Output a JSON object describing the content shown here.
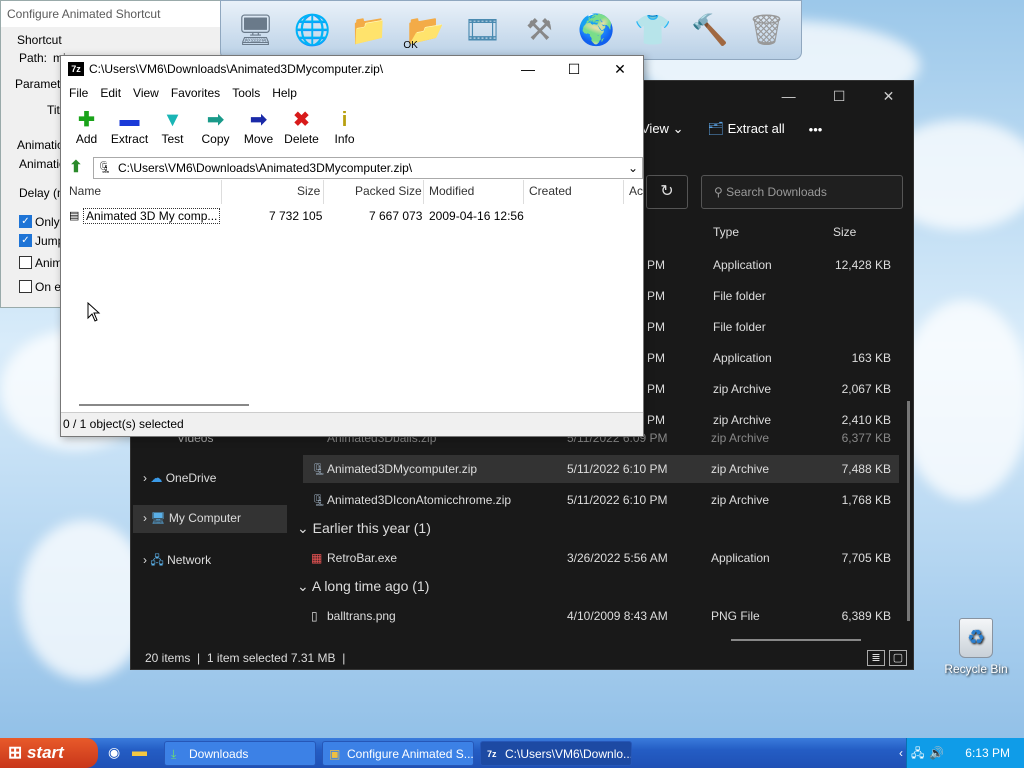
{
  "desktop": {
    "recycle_bin": "Recycle Bin"
  },
  "configure_window": {
    "title": "Configure Animated Shortcut",
    "shortcut_group": "Shortcut",
    "path_label": "Path:",
    "path_value": "mi...",
    "parameters_label": "Paramete",
    "title_label": "Titl",
    "animation_label_1": "Animatio",
    "animation_label_2": "Animatio",
    "delay_label": "Delay (m",
    "only_label": "Only",
    "jump_label": "Jump",
    "anim_label": "Anim",
    "on_label": "On e",
    "ok_label": "OK"
  },
  "zip": {
    "title": "C:\\Users\\VM6\\Downloads\\Animated3DMycomputer.zip\\",
    "menu": [
      "File",
      "Edit",
      "View",
      "Favorites",
      "Tools",
      "Help"
    ],
    "tools": [
      {
        "label": "Add",
        "glyph": "✚",
        "color": "#1aa31a"
      },
      {
        "label": "Extract",
        "glyph": "▬",
        "color": "#1a3ad8"
      },
      {
        "label": "Test",
        "glyph": "▼",
        "color": "#19b5b5"
      },
      {
        "label": "Copy",
        "glyph": "➡",
        "color": "#1a9a8a"
      },
      {
        "label": "Move",
        "glyph": "➡",
        "color": "#1a2aa8"
      },
      {
        "label": "Delete",
        "glyph": "✖",
        "color": "#d81a1a"
      },
      {
        "label": "Info",
        "glyph": "i",
        "color": "#b8a010"
      }
    ],
    "address": "C:\\Users\\VM6\\Downloads\\Animated3DMycomputer.zip\\",
    "columns": {
      "name": "Name",
      "size": "Size",
      "packed": "Packed Size",
      "modified": "Modified",
      "created": "Created",
      "accessed": "Ac"
    },
    "file": {
      "name": "Animated 3D My comp...",
      "size": "7 732 105",
      "packed": "7 667 073",
      "modified": "2009-04-16 12:56"
    },
    "status": "0 / 1 object(s) selected"
  },
  "explorer": {
    "view_label": "View",
    "extract_all": "Extract all",
    "more": "•••",
    "search_placeholder": "Search Downloads",
    "col_type": "Type",
    "col_size": "Size",
    "rows_top": [
      {
        "date": "PM",
        "type": "Application",
        "size": "12,428 KB"
      },
      {
        "date": "PM",
        "type": "File folder",
        "size": ""
      },
      {
        "date": "PM",
        "type": "File folder",
        "size": ""
      },
      {
        "date": "PM",
        "type": "Application",
        "size": "163 KB"
      },
      {
        "date": "PM",
        "type": "zip Archive",
        "size": "2,067 KB"
      },
      {
        "date": "PM",
        "type": "zip Archive",
        "size": "2,410 KB"
      },
      {
        "date": "5/11/2022 6:09 PM",
        "type": "zip Archive",
        "size": "6,377 KB",
        "name": "Animated3Dballs.zip"
      }
    ],
    "row_selected": {
      "name": "Animated3DMycomputer.zip",
      "date": "5/11/2022 6:10 PM",
      "type": "zip Archive",
      "size": "7,488 KB"
    },
    "row_atomic": {
      "name": "Animated3DIconAtomicchrome.zip",
      "date": "5/11/2022 6:10 PM",
      "type": "zip Archive",
      "size": "1,768 KB"
    },
    "group_year": "Earlier this year (1)",
    "row_retro": {
      "name": "RetroBar.exe",
      "date": "3/26/2022 5:56 AM",
      "type": "Application",
      "size": "7,705 KB"
    },
    "group_long": "A long time ago (1)",
    "row_ball": {
      "name": "balltrans.png",
      "date": "4/10/2009 8:43 AM",
      "type": "PNG File",
      "size": "6,389 KB"
    },
    "nav": {
      "videos": "Videos",
      "onedrive": "OneDrive",
      "mycomputer": "My Computer",
      "network": "Network"
    },
    "status": {
      "items": "20 items",
      "selected": "1 item selected  7.31 MB"
    }
  },
  "taskbar": {
    "start": "start",
    "buttons": [
      "Downloads",
      "Configure Animated S...",
      "C:\\Users\\VM6\\Downlo..."
    ],
    "clock": "6:13 PM"
  }
}
